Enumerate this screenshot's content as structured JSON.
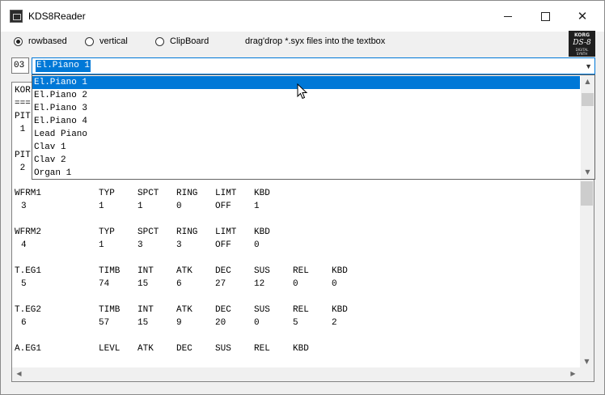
{
  "window": {
    "title": "KDS8Reader"
  },
  "title_controls": {
    "minimize": "",
    "maximize": "",
    "close": "✕"
  },
  "options": {
    "rowbased": "rowbased",
    "vertical": "vertical",
    "clipboard": "ClipBoard",
    "selected": "rowbased",
    "hint": "drag'drop *.syx files into the textbox"
  },
  "logo": {
    "brand": "KORG",
    "model": "DS-8",
    "sub1": "DIGITAL",
    "sub2": "SYNTH"
  },
  "program": {
    "number": "03",
    "selected_name": "El.Piano 1"
  },
  "dropdown": {
    "items": [
      "El.Piano 1",
      "El.Piano 2",
      "El.Piano 3",
      "El.Piano 4",
      "Lead Piano",
      "Clav 1",
      "Clav 2",
      "Organ 1"
    ],
    "selected_index": 0
  },
  "textbox": {
    "hidden_left": [
      "KOR",
      "===",
      "PIT",
      " 1",
      "",
      "PIT",
      " 2"
    ],
    "rows": [
      [
        "WFRM1",
        "TYP",
        "SPCT",
        "RING",
        "LIMT",
        "KBD"
      ],
      [
        "3",
        "1",
        "1",
        "0",
        "OFF",
        "1"
      ],
      [
        "WFRM2",
        "TYP",
        "SPCT",
        "RING",
        "LIMT",
        "KBD"
      ],
      [
        "4",
        "1",
        "3",
        "3",
        "OFF",
        "0"
      ],
      [
        "T.EG1",
        "TIMB",
        "INT",
        "ATK",
        "DEC",
        "SUS",
        "REL",
        "KBD"
      ],
      [
        "5",
        "74",
        "15",
        "6",
        "27",
        "12",
        "0",
        "0"
      ],
      [
        "T.EG2",
        "TIMB",
        "INT",
        "ATK",
        "DEC",
        "SUS",
        "REL",
        "KBD"
      ],
      [
        "6",
        "57",
        "15",
        "9",
        "20",
        "0",
        "5",
        "2"
      ],
      [
        "A.EG1",
        "LEVL",
        "ATK",
        "DEC",
        "SUS",
        "REL",
        "KBD"
      ]
    ]
  }
}
